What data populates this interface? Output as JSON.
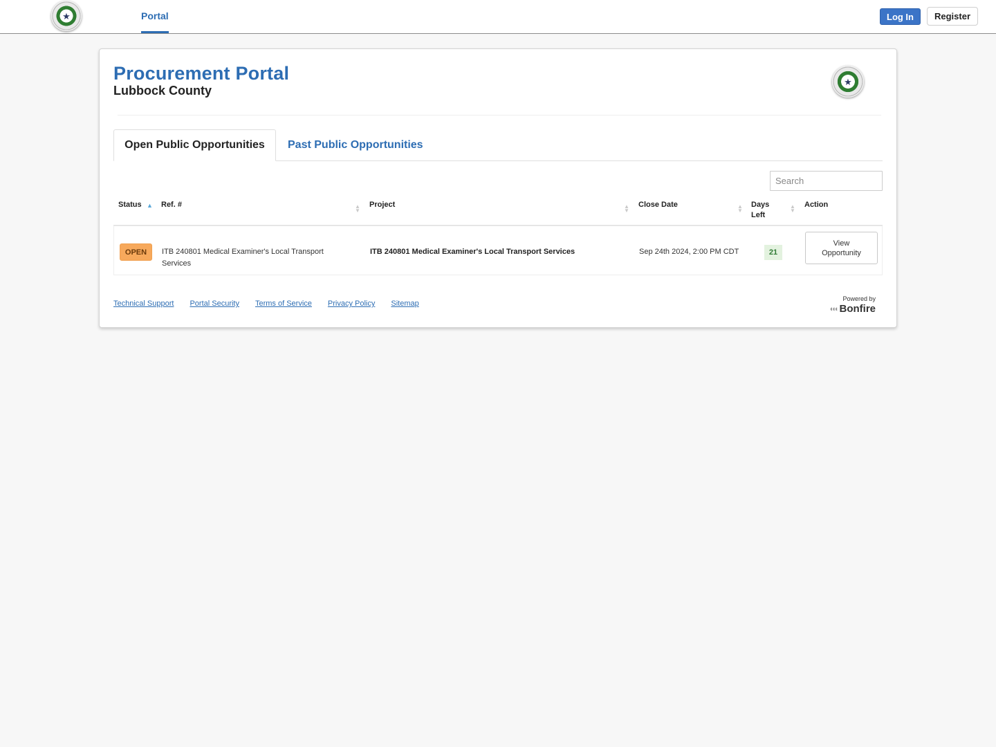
{
  "topbar": {
    "logo": "county-seal-icon",
    "nav_items": [
      {
        "label": "Portal",
        "active": true
      }
    ],
    "login_label": "Log In",
    "register_label": "Register",
    "accent_color": "#2d6db3"
  },
  "header": {
    "title": "Procurement Portal",
    "subtitle": "Lubbock County",
    "logo": "county-seal-icon"
  },
  "tabs": [
    {
      "label": "Open Public Opportunities",
      "active": true
    },
    {
      "label": "Past Public Opportunities",
      "active": false
    }
  ],
  "search": {
    "placeholder": "Search",
    "value": ""
  },
  "table": {
    "columns": [
      {
        "label": "Status",
        "sort": "ascending"
      },
      {
        "label": "Ref. #",
        "sort": "none"
      },
      {
        "label": "Project",
        "sort": "none"
      },
      {
        "label": "Close Date",
        "sort": "none"
      },
      {
        "label": "Days Left",
        "sort": "none"
      },
      {
        "label": "Action",
        "sort": "none"
      }
    ],
    "rows": [
      {
        "status": "OPEN",
        "ref": "ITB 240801 Medical Examiner's Local Transport Services",
        "project": "ITB 240801 Medical Examiner's Local Transport Services",
        "close_date": "Sep 24th 2024, 2:00 PM CDT",
        "days_left": "21",
        "action_label": "View Opportunity"
      }
    ],
    "status_color": "#f7a95c",
    "days_left_color": "#2f7a34"
  },
  "footer": {
    "links": [
      "Technical Support",
      "Portal Security",
      "Terms of Service",
      "Privacy Policy",
      "Sitemap"
    ],
    "powered_by": "Powered by",
    "brand": "Bonfire",
    "brand_icon": "bonfire-flame-icon"
  }
}
